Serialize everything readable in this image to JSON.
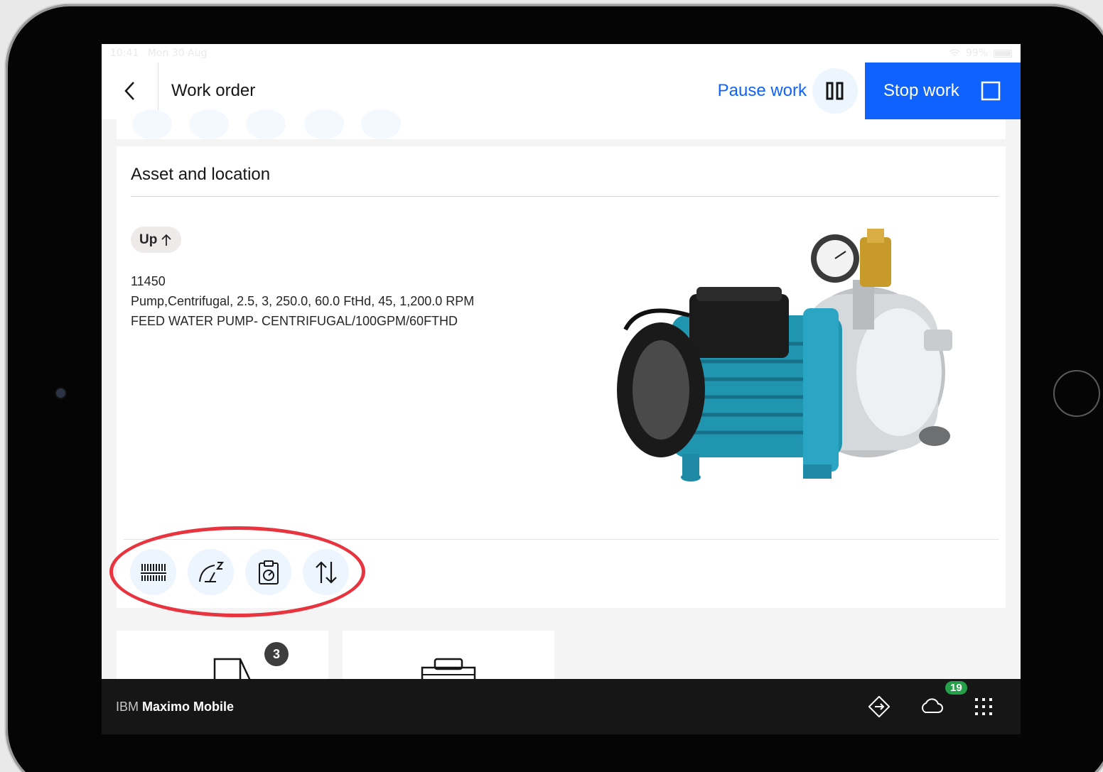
{
  "status_bar": {
    "time": "10:41",
    "date": "Mon 30 Aug",
    "battery": "99%"
  },
  "header": {
    "back_icon": "chevron-left-icon",
    "title": "Work order",
    "pause_label": "Pause work",
    "pause_icon": "pause-icon",
    "stop_label": "Stop work",
    "stop_icon": "stop-icon",
    "accent_color": "#0f62fe"
  },
  "asset_card": {
    "title": "Asset and location",
    "status_tag": "Up",
    "status_icon": "arrow-up-icon",
    "asset_number": "11450",
    "spec_line": "Pump,Centrifugal, 2.5, 3, 250.0, 60.0 FtHd, 45, 1,200.0 RPM",
    "description": "FEED WATER PUMP- CENTRIFUGAL/100GPM/60FTHD",
    "image_icon": "centrifugal-pump-photo",
    "actions": [
      {
        "icon": "barcode-icon"
      },
      {
        "icon": "meter-icon"
      },
      {
        "icon": "clipboard-report-icon"
      },
      {
        "icon": "sort-arrows-icon"
      }
    ],
    "highlight_color": "#e8343e"
  },
  "tiles": [
    {
      "icon": "document-icon",
      "badge": "3"
    },
    {
      "icon": "toolbox-icon"
    }
  ],
  "bottom_bar": {
    "brand_prefix": "IBM",
    "brand_name": "Maximo Mobile",
    "nav_icon": "direction-diamond-icon",
    "cloud_icon": "cloud-icon",
    "sync_count": "19",
    "apps_icon": "app-grid-icon"
  }
}
